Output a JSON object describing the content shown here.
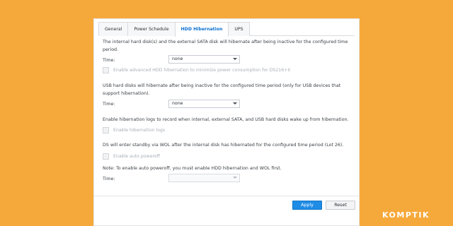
{
  "tabs": [
    {
      "label": "General"
    },
    {
      "label": "Power Schedule"
    },
    {
      "label": "HDD Hibernation"
    },
    {
      "label": "UPS"
    }
  ],
  "section1": {
    "text": "The internal hard disk(s) and the external SATA disk will hibernate after being inactive for the configured time period.",
    "time_label": "Time:",
    "time_value": "none",
    "checkbox_label": "Enable advanced HDD hibernation to minimize power consumption for DS216+II"
  },
  "section2": {
    "text": "USB hard disks will hibernate after being inactive for the configured time period (only for USB devices that support hibernation).",
    "time_label": "Time:",
    "time_value": "none"
  },
  "section3": {
    "text": "Enable hibernation logs to record when internal, external SATA, and USB hard disks wake up from hibernation.",
    "checkbox_label": "Enable hibernation logs"
  },
  "section4": {
    "text": "DS will enter standby via WOL after the internal disk has hibernated for the configured time period (Lot 26).",
    "checkbox_label": "Enable auto poweroff",
    "note": "Note: To enable auto poweroff, you must enable HDD hibernation and WOL first.",
    "time_label": "Time:",
    "time_value": ""
  },
  "footer": {
    "apply_label": "Apply",
    "reset_label": "Reset"
  },
  "colors": {
    "background": "#f6a93b",
    "accent": "#1f8ce6"
  },
  "brand": "KOMPTIK"
}
